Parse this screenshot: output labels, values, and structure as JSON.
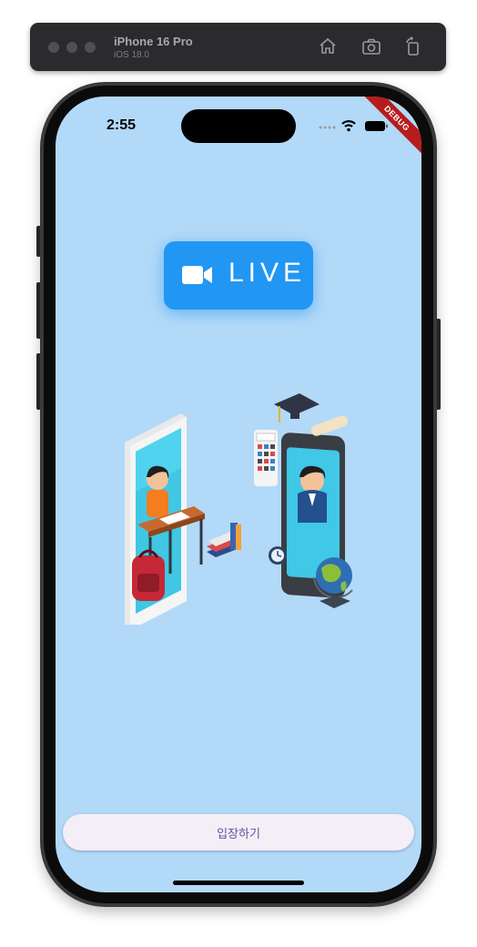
{
  "simulator": {
    "device_name": "iPhone 16 Pro",
    "os_version": "iOS 18.0",
    "icons": [
      "home-icon",
      "screenshot-icon",
      "rotate-icon"
    ]
  },
  "status_bar": {
    "time": "2:55",
    "icons": [
      "signal-icon",
      "wifi-icon",
      "battery-icon"
    ]
  },
  "debug_banner": "DEBUG",
  "live_badge": {
    "icon": "video-camera-icon",
    "label": "LIVE"
  },
  "illustration": {
    "icon": "online-learning-illustration"
  },
  "enter_button": {
    "label": "입장하기"
  },
  "colors": {
    "screen_background": "#b3d9f8",
    "accent_blue": "#2196f3",
    "button_background": "#f4eef6",
    "button_text": "#6a4fa0",
    "debug_ribbon": "#b71c1c"
  }
}
